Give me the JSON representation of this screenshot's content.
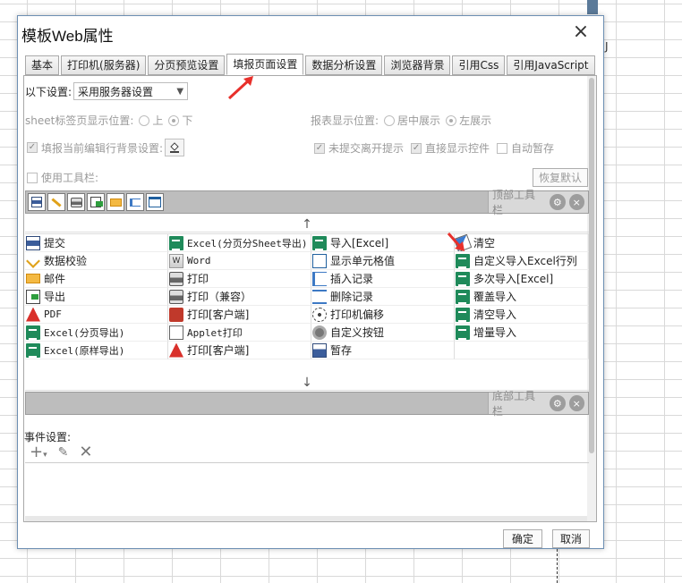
{
  "background": {
    "column_letter": "J"
  },
  "dialog": {
    "title": "模板Web属性",
    "tabs": [
      {
        "label": "基本",
        "active": false
      },
      {
        "label": "打印机(服务器)",
        "active": false
      },
      {
        "label": "分页预览设置",
        "active": false
      },
      {
        "label": "填报页面设置",
        "active": true
      },
      {
        "label": "数据分析设置",
        "active": false
      },
      {
        "label": "浏览器背景",
        "active": false
      },
      {
        "label": "引用Css",
        "active": false
      },
      {
        "label": "引用JavaScript",
        "active": false
      }
    ],
    "settings": {
      "following_label": "以下设置:",
      "following_value": "采用服务器设置",
      "sheet_pos_label": "sheet标签页显示位置:",
      "sheet_pos_top": "上",
      "sheet_pos_bottom": "下",
      "report_pos_label": "报表显示位置:",
      "report_pos_center": "居中展示",
      "report_pos_left": "左展示",
      "fill_bg_label": "填报当前编辑行背景设置:",
      "unsubmitted_label": "未提交离开提示",
      "direct_show_label": "直接显示控件",
      "auto_save_label": "自动暂存",
      "use_toolbar_label": "使用工具栏:",
      "restore_default": "恢复默认"
    },
    "top_toolbar_label": "顶部工具栏",
    "bottom_toolbar_label": "底部工具栏",
    "buttons": [
      [
        "提交",
        "Excel(分页分Sheet导出)",
        "导入[Excel]",
        "清空"
      ],
      [
        "数据校验",
        "Word",
        "显示单元格值",
        "自定义导入Excel行列"
      ],
      [
        "邮件",
        "打印",
        "插入记录",
        "多次导入[Excel]"
      ],
      [
        "导出",
        "打印（兼容）",
        "删除记录",
        "覆盖导入"
      ],
      [
        "PDF",
        "打印[客户端]",
        "打印机偏移",
        "清空导入"
      ],
      [
        "Excel(分页导出)",
        "Applet打印",
        "自定义按钮",
        "增量导入"
      ],
      [
        "Excel(原样导出)",
        "打印[客户端]",
        "暂存",
        ""
      ]
    ],
    "event_label": "事件设置:",
    "ok": "确定",
    "cancel": "取消",
    "close_icon": "×",
    "up_arrow": "↑",
    "down_arrow": "↓"
  }
}
